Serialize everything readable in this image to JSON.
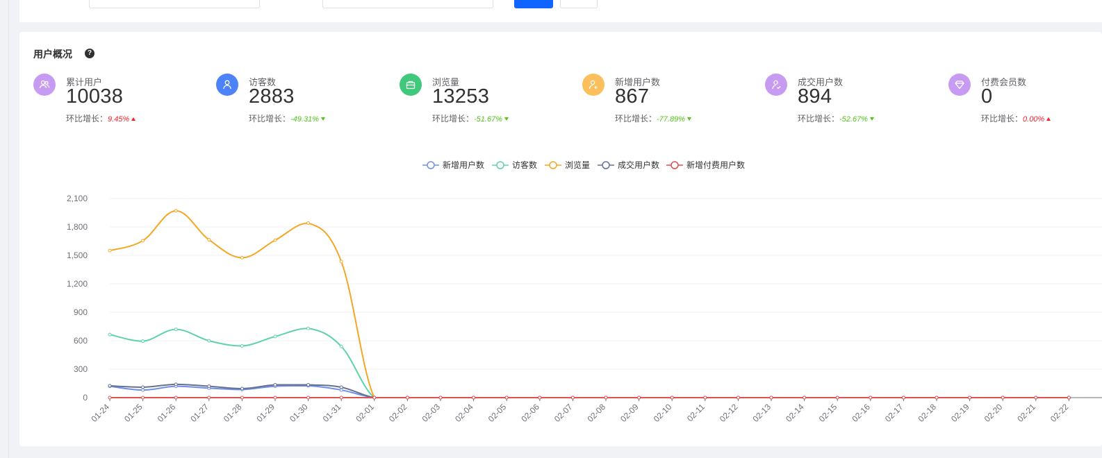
{
  "overview": {
    "title": "用户概况",
    "help_icon": "question-circle-icon",
    "stats": [
      {
        "label": "累计用户",
        "value": "10038",
        "change_label": "环比增长：",
        "change": "9.45%",
        "direction": "up",
        "icon": "users-icon",
        "color": "#c79bf2"
      },
      {
        "label": "访客数",
        "value": "2883",
        "change_label": "环比增长：",
        "change": "-49.31%",
        "direction": "down",
        "icon": "user-icon",
        "color": "#4c83f8"
      },
      {
        "label": "浏览量",
        "value": "13253",
        "change_label": "环比增长：",
        "change": "-51.67%",
        "direction": "down",
        "icon": "briefcase-icon",
        "color": "#40c97c"
      },
      {
        "label": "新增用户数",
        "value": "867",
        "change_label": "环比增长：",
        "change": "-77.89%",
        "direction": "down",
        "icon": "user-add-icon",
        "color": "#fbbf5b"
      },
      {
        "label": "成交用户数",
        "value": "894",
        "change_label": "环比增长：",
        "change": "-52.67%",
        "direction": "down",
        "icon": "user-check-icon",
        "color": "#c79bf2"
      },
      {
        "label": "付费会员数",
        "value": "0",
        "change_label": "环比增长：",
        "change": "0.00%",
        "direction": "up",
        "icon": "diamond-icon",
        "color": "#c79bf2"
      }
    ]
  },
  "chart_data": {
    "type": "line",
    "legend_position": "top-center",
    "grid": true,
    "ylim": [
      0,
      2100
    ],
    "yticks": [
      0,
      300,
      600,
      900,
      1200,
      1500,
      1800,
      2100
    ],
    "ytick_labels": [
      "0",
      "300",
      "600",
      "900",
      "1,200",
      "1,500",
      "1,800",
      "2,100"
    ],
    "categories": [
      "01-24",
      "01-25",
      "01-26",
      "01-27",
      "01-28",
      "01-29",
      "01-30",
      "01-31",
      "02-01",
      "02-02",
      "02-03",
      "02-04",
      "02-05",
      "02-06",
      "02-07",
      "02-08",
      "02-09",
      "02-10",
      "02-11",
      "02-12",
      "02-13",
      "02-14",
      "02-15",
      "02-16",
      "02-17",
      "02-18",
      "02-19",
      "02-20",
      "02-21",
      "02-22"
    ],
    "series": [
      {
        "name": "新增用户数",
        "color": "#6f8ee8",
        "values": [
          120,
          80,
          120,
          100,
          85,
          120,
          125,
          80,
          0,
          0,
          0,
          0,
          0,
          0,
          0,
          0,
          0,
          0,
          0,
          0,
          0,
          0,
          0,
          0,
          0,
          0,
          0,
          0,
          0,
          0
        ]
      },
      {
        "name": "访客数",
        "color": "#5fd3a7",
        "values": [
          665,
          595,
          720,
          600,
          545,
          645,
          730,
          540,
          0,
          0,
          0,
          0,
          0,
          0,
          0,
          0,
          0,
          0,
          0,
          0,
          0,
          0,
          0,
          0,
          0,
          0,
          0,
          0,
          0,
          0
        ]
      },
      {
        "name": "浏览量",
        "color": "#f5a623",
        "values": [
          1550,
          1655,
          1970,
          1665,
          1475,
          1660,
          1840,
          1435,
          0,
          0,
          0,
          0,
          0,
          0,
          0,
          0,
          0,
          0,
          0,
          0,
          0,
          0,
          0,
          0,
          0,
          0,
          0,
          0,
          0,
          0
        ]
      },
      {
        "name": "成交用户数",
        "color": "#667090",
        "values": [
          125,
          110,
          140,
          120,
          95,
          135,
          135,
          110,
          0,
          0,
          0,
          0,
          0,
          0,
          0,
          0,
          0,
          0,
          0,
          0,
          0,
          0,
          0,
          0,
          0,
          0,
          0,
          0,
          0,
          0
        ]
      },
      {
        "name": "新增付费用户数",
        "color": "#e0504f",
        "values": [
          0,
          0,
          0,
          0,
          0,
          0,
          0,
          0,
          0,
          0,
          0,
          0,
          0,
          0,
          0,
          0,
          0,
          0,
          0,
          0,
          0,
          0,
          0,
          0,
          0,
          0,
          0,
          0,
          0,
          0
        ]
      }
    ]
  }
}
